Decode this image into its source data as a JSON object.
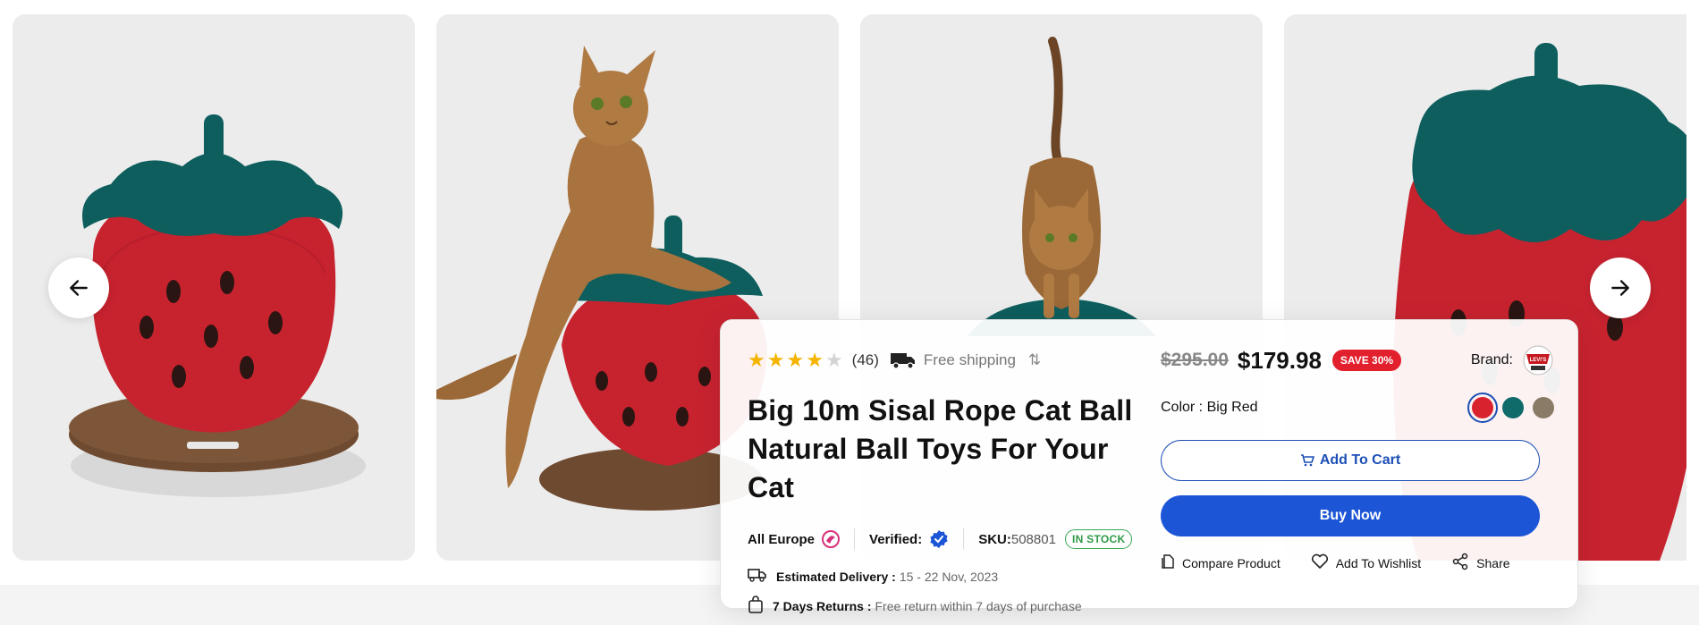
{
  "gallery": {
    "prev_label": "previous",
    "next_label": "next"
  },
  "product": {
    "rating": 4,
    "max_rating": 5,
    "reviews": "(46)",
    "shipping": "Free shipping",
    "title_line1": "Big 10m Sisal Rope Cat Ball",
    "title_line2": "Natural Ball Toys For Your Cat",
    "region": "All Europe",
    "verified_label": "Verified:",
    "sku_label": "SKU:",
    "sku_value": "508801",
    "stock": "IN STOCK",
    "delivery_label": "Estimated Delivery :",
    "delivery_value": "15 - 22 Nov, 2023",
    "returns_label": "7 Days Returns :",
    "returns_value": "Free return within 7 days of purchase",
    "old_price": "$295.00",
    "price": "$179.98",
    "save_badge": "SAVE 30%",
    "brand_label": "Brand:",
    "brand_logo_text": "LEVI'S",
    "color_label": "Color : Big Red",
    "colors": [
      "#d8222e",
      "#0f6a6a",
      "#8a7b66"
    ],
    "selected_color": 0,
    "add_to_cart": "Add To Cart",
    "buy_now": "Buy Now",
    "compare": "Compare Product",
    "wishlist": "Add To Wishlist",
    "share": "Share"
  },
  "colors": {
    "accent": "#1c55d6",
    "save": "#e21f2d",
    "stock": "#2e9a47",
    "star": "#f5b400"
  }
}
